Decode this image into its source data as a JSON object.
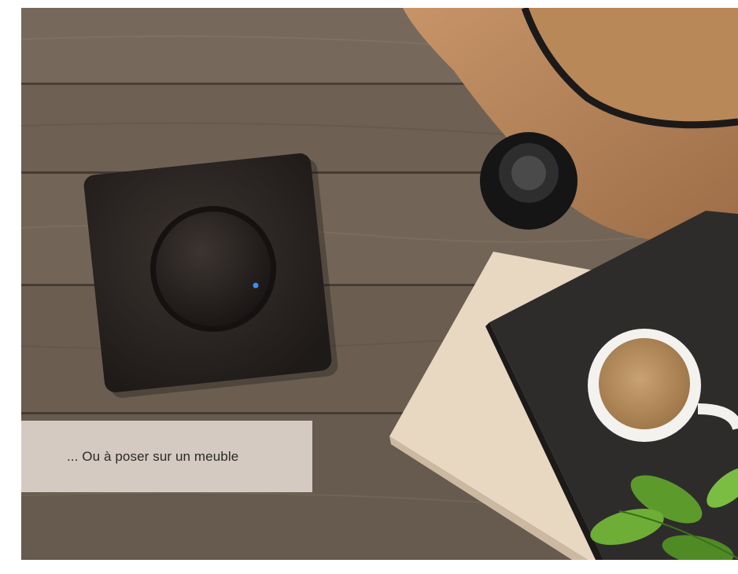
{
  "caption": {
    "text": "... Ou à poser sur un meuble"
  },
  "scene": {
    "objects": [
      "wooden-table",
      "wall-switch",
      "felt-hat",
      "glass-bottle",
      "kraft-notebook",
      "black-notebook",
      "coffee-cup",
      "green-leaves"
    ]
  },
  "colors": {
    "wood": "#6d5f52",
    "switch": "#2a2522",
    "hat": "#b07f56",
    "notebook_kraft": "#e8d8c2",
    "notebook_black": "#2d2c2b",
    "coffee": "#b7905f",
    "leaf": "#5d9a2c",
    "led": "#3b8cff"
  }
}
